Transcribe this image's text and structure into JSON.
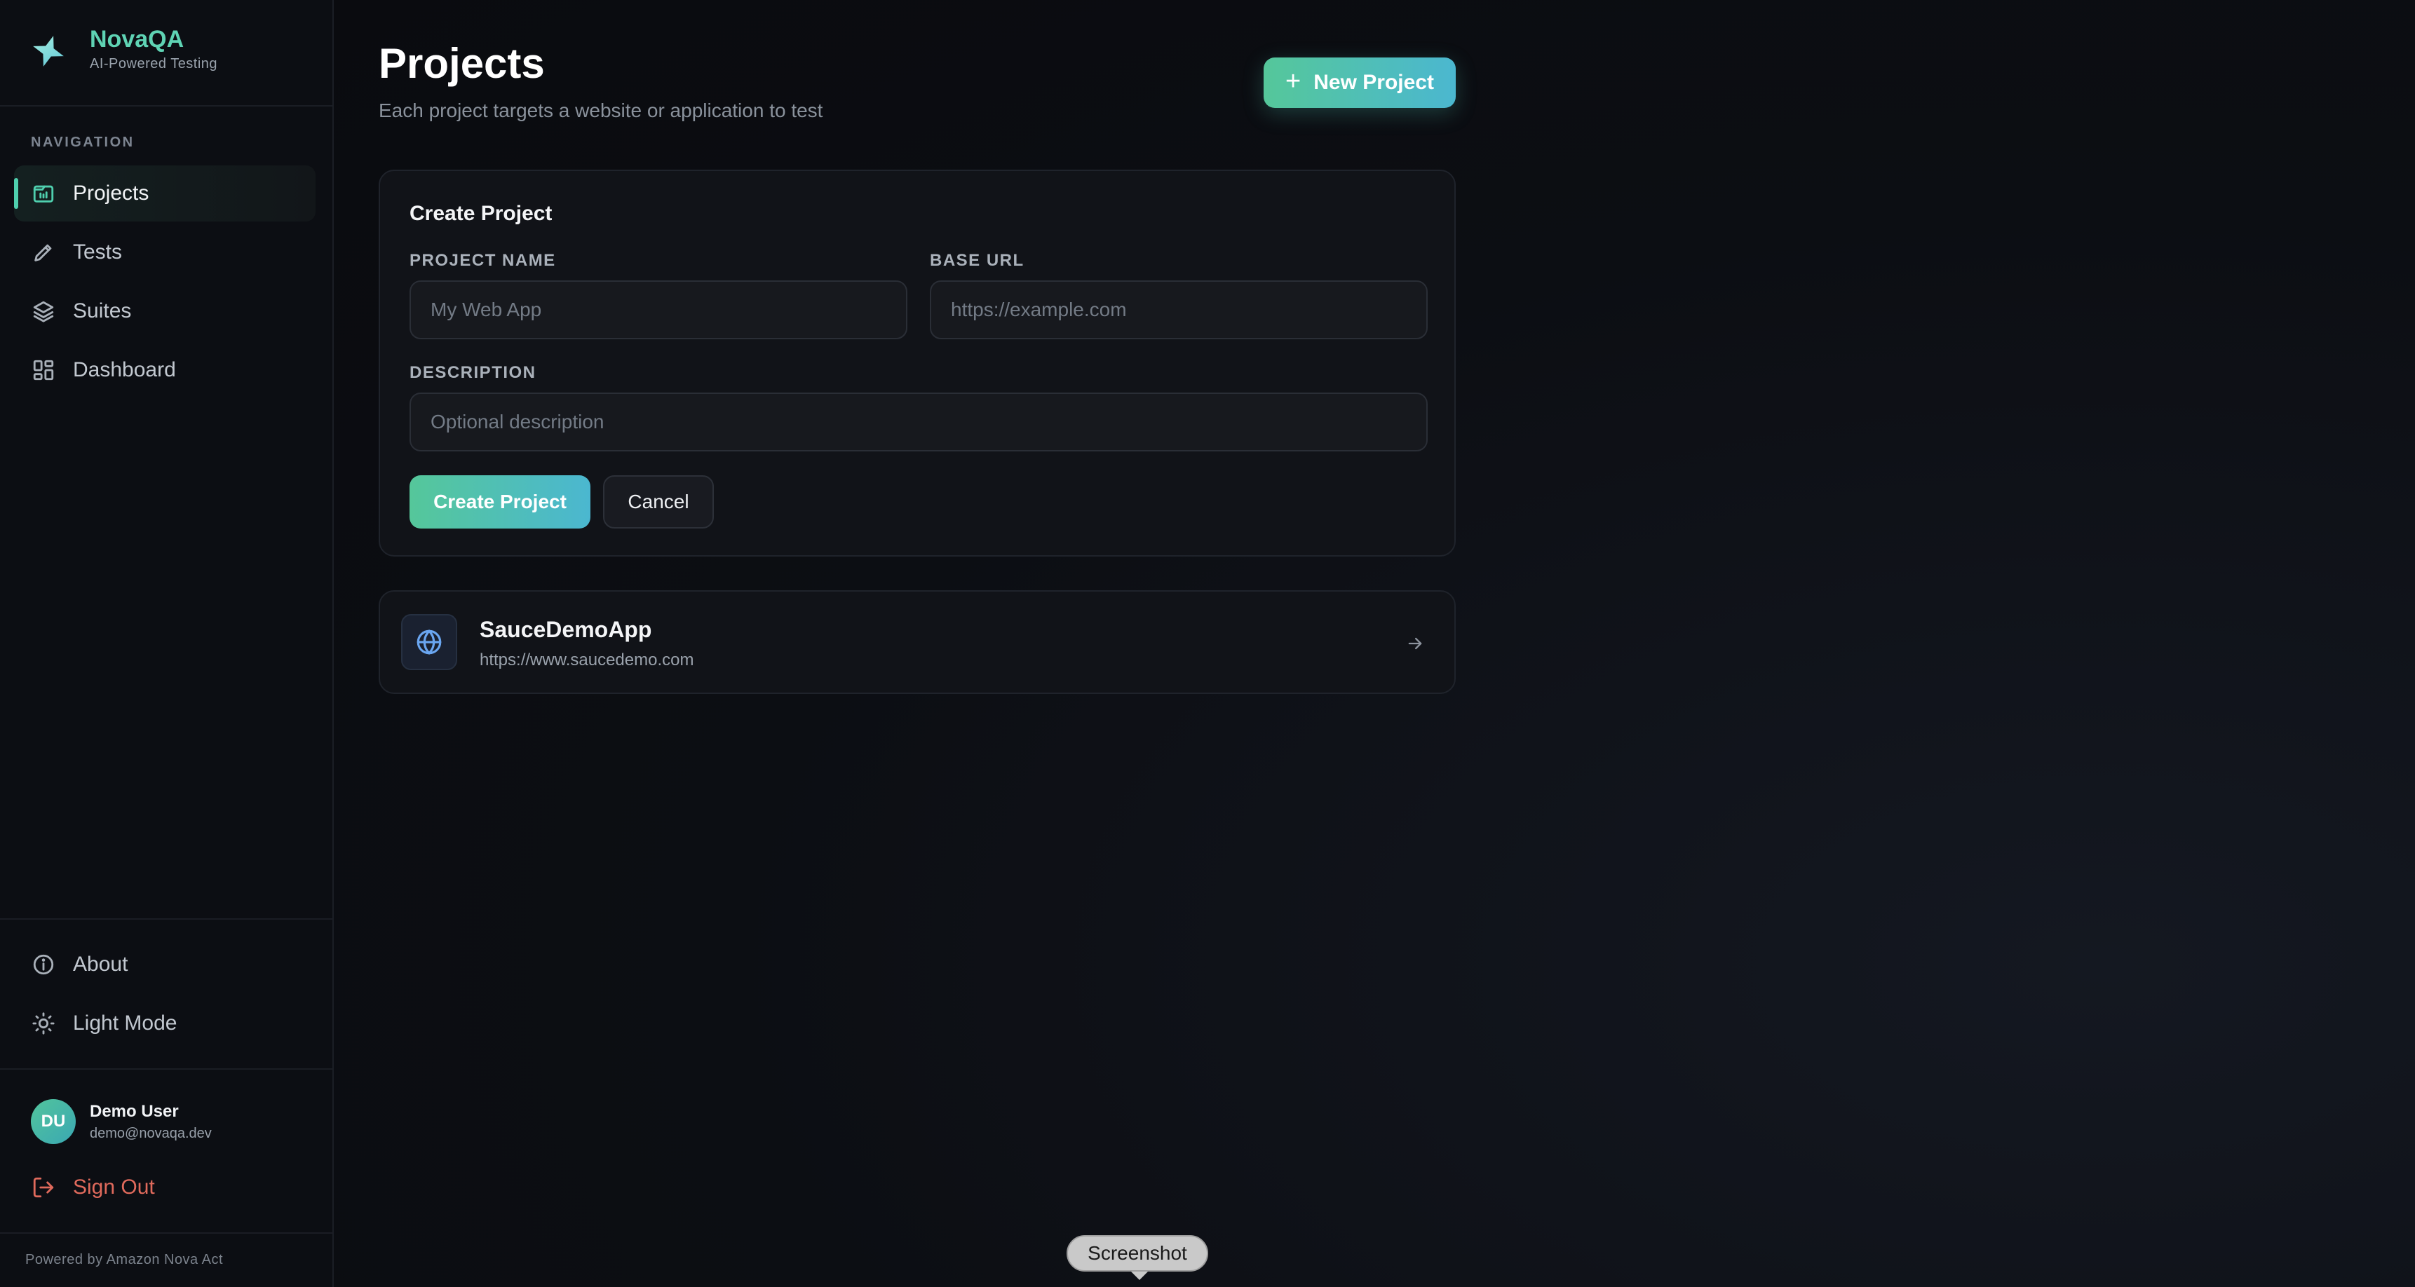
{
  "brand": {
    "name": "NovaQA",
    "tagline": "AI-Powered Testing"
  },
  "sidebar": {
    "nav_heading": "NAVIGATION",
    "items": [
      {
        "label": "Projects",
        "icon": "folder-icon",
        "active": true
      },
      {
        "label": "Tests",
        "icon": "pencil-icon",
        "active": false
      },
      {
        "label": "Suites",
        "icon": "layers-icon",
        "active": false
      },
      {
        "label": "Dashboard",
        "icon": "grid-icon",
        "active": false
      }
    ],
    "footer_items": [
      {
        "label": "About",
        "icon": "info-icon"
      },
      {
        "label": "Light Mode",
        "icon": "sun-icon"
      }
    ],
    "user": {
      "initials": "DU",
      "name": "Demo User",
      "email": "demo@novaqa.dev"
    },
    "sign_out_label": "Sign Out",
    "powered_by": "Powered by Amazon Nova Act"
  },
  "header": {
    "title": "Projects",
    "subtitle": "Each project targets a website or application to test",
    "new_project_label": "New Project"
  },
  "create_form": {
    "title": "Create Project",
    "project_name": {
      "label": "PROJECT NAME",
      "value": "",
      "placeholder": "My Web App"
    },
    "base_url": {
      "label": "BASE URL",
      "value": "",
      "placeholder": "https://example.com"
    },
    "description": {
      "label": "DESCRIPTION",
      "value": "",
      "placeholder": "Optional description"
    },
    "submit_label": "Create Project",
    "cancel_label": "Cancel"
  },
  "projects": [
    {
      "name": "SauceDemoApp",
      "url": "https://www.saucedemo.com",
      "icon": "globe-icon"
    }
  ],
  "tooltip": {
    "label": "Screenshot"
  },
  "colors": {
    "accent": "#4fcfae",
    "gradient_start": "#55c79a",
    "gradient_end": "#4bb7d0",
    "danger": "#e06a5c",
    "background": "#0b0c10"
  }
}
